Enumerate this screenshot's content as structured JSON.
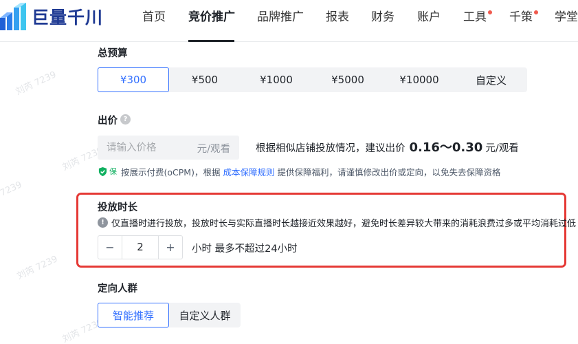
{
  "brand": {
    "name": "巨量千川"
  },
  "nav": {
    "items": [
      {
        "label": "首页"
      },
      {
        "label": "竞价推广"
      },
      {
        "label": "品牌推广"
      },
      {
        "label": "报表"
      },
      {
        "label": "财务"
      },
      {
        "label": "账户"
      },
      {
        "label": "工具"
      },
      {
        "label": "千策"
      },
      {
        "label": "学堂"
      }
    ],
    "active_index": 1,
    "notice_dot_color": "#f05a4e"
  },
  "budget": {
    "title": "总预算",
    "options": [
      "¥300",
      "¥500",
      "¥1000",
      "¥5000",
      "¥10000",
      "自定义"
    ],
    "selected": "¥300"
  },
  "bid": {
    "title": "出价",
    "help_icon": "question-circle-icon",
    "input": {
      "placeholder": "请输入价格",
      "value": "",
      "unit": "元/观看"
    },
    "suggest_prefix": "根据相似店铺投放情况，建议出价",
    "suggest_range": "0.16～0.30",
    "suggest_unit": "元/观看",
    "guarantee": {
      "badge": "保",
      "text_before": "按展示付费(oCPM)，根据",
      "link": "成本保障规则",
      "text_after": "提供保障福利，请谨慎修改出价或定向，以免失去保障资格"
    }
  },
  "duration": {
    "title": "投放时长",
    "info": "仅直播时进行投放，投放时长与实际直播时长越接近效果越好，避免时长差异较大带来的消耗浪费过多或平均消耗过低",
    "value": "2",
    "decrement": "−",
    "increment": "+",
    "note": "小时 最多不超过24小时"
  },
  "audience": {
    "title": "定向人群",
    "options": [
      "智能推荐",
      "自定义人群"
    ],
    "selected": "智能推荐"
  },
  "watermark": "刘芮 7239",
  "colors": {
    "accent": "#3370ff",
    "highlight_border": "#e53935",
    "success": "#10b060"
  }
}
